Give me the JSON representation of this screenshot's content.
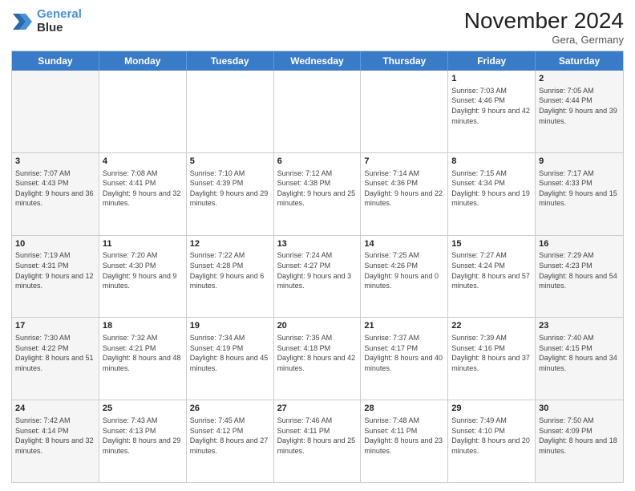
{
  "header": {
    "logo_line1": "General",
    "logo_line2": "Blue",
    "month": "November 2024",
    "location": "Gera, Germany"
  },
  "weekdays": [
    "Sunday",
    "Monday",
    "Tuesday",
    "Wednesday",
    "Thursday",
    "Friday",
    "Saturday"
  ],
  "rows": [
    [
      {
        "day": "",
        "info": ""
      },
      {
        "day": "",
        "info": ""
      },
      {
        "day": "",
        "info": ""
      },
      {
        "day": "",
        "info": ""
      },
      {
        "day": "",
        "info": ""
      },
      {
        "day": "1",
        "info": "Sunrise: 7:03 AM\nSunset: 4:46 PM\nDaylight: 9 hours and 42 minutes."
      },
      {
        "day": "2",
        "info": "Sunrise: 7:05 AM\nSunset: 4:44 PM\nDaylight: 9 hours and 39 minutes."
      }
    ],
    [
      {
        "day": "3",
        "info": "Sunrise: 7:07 AM\nSunset: 4:43 PM\nDaylight: 9 hours and 36 minutes."
      },
      {
        "day": "4",
        "info": "Sunrise: 7:08 AM\nSunset: 4:41 PM\nDaylight: 9 hours and 32 minutes."
      },
      {
        "day": "5",
        "info": "Sunrise: 7:10 AM\nSunset: 4:39 PM\nDaylight: 9 hours and 29 minutes."
      },
      {
        "day": "6",
        "info": "Sunrise: 7:12 AM\nSunset: 4:38 PM\nDaylight: 9 hours and 25 minutes."
      },
      {
        "day": "7",
        "info": "Sunrise: 7:14 AM\nSunset: 4:36 PM\nDaylight: 9 hours and 22 minutes."
      },
      {
        "day": "8",
        "info": "Sunrise: 7:15 AM\nSunset: 4:34 PM\nDaylight: 9 hours and 19 minutes."
      },
      {
        "day": "9",
        "info": "Sunrise: 7:17 AM\nSunset: 4:33 PM\nDaylight: 9 hours and 15 minutes."
      }
    ],
    [
      {
        "day": "10",
        "info": "Sunrise: 7:19 AM\nSunset: 4:31 PM\nDaylight: 9 hours and 12 minutes."
      },
      {
        "day": "11",
        "info": "Sunrise: 7:20 AM\nSunset: 4:30 PM\nDaylight: 9 hours and 9 minutes."
      },
      {
        "day": "12",
        "info": "Sunrise: 7:22 AM\nSunset: 4:28 PM\nDaylight: 9 hours and 6 minutes."
      },
      {
        "day": "13",
        "info": "Sunrise: 7:24 AM\nSunset: 4:27 PM\nDaylight: 9 hours and 3 minutes."
      },
      {
        "day": "14",
        "info": "Sunrise: 7:25 AM\nSunset: 4:26 PM\nDaylight: 9 hours and 0 minutes."
      },
      {
        "day": "15",
        "info": "Sunrise: 7:27 AM\nSunset: 4:24 PM\nDaylight: 8 hours and 57 minutes."
      },
      {
        "day": "16",
        "info": "Sunrise: 7:29 AM\nSunset: 4:23 PM\nDaylight: 8 hours and 54 minutes."
      }
    ],
    [
      {
        "day": "17",
        "info": "Sunrise: 7:30 AM\nSunset: 4:22 PM\nDaylight: 8 hours and 51 minutes."
      },
      {
        "day": "18",
        "info": "Sunrise: 7:32 AM\nSunset: 4:21 PM\nDaylight: 8 hours and 48 minutes."
      },
      {
        "day": "19",
        "info": "Sunrise: 7:34 AM\nSunset: 4:19 PM\nDaylight: 8 hours and 45 minutes."
      },
      {
        "day": "20",
        "info": "Sunrise: 7:35 AM\nSunset: 4:18 PM\nDaylight: 8 hours and 42 minutes."
      },
      {
        "day": "21",
        "info": "Sunrise: 7:37 AM\nSunset: 4:17 PM\nDaylight: 8 hours and 40 minutes."
      },
      {
        "day": "22",
        "info": "Sunrise: 7:39 AM\nSunset: 4:16 PM\nDaylight: 8 hours and 37 minutes."
      },
      {
        "day": "23",
        "info": "Sunrise: 7:40 AM\nSunset: 4:15 PM\nDaylight: 8 hours and 34 minutes."
      }
    ],
    [
      {
        "day": "24",
        "info": "Sunrise: 7:42 AM\nSunset: 4:14 PM\nDaylight: 8 hours and 32 minutes."
      },
      {
        "day": "25",
        "info": "Sunrise: 7:43 AM\nSunset: 4:13 PM\nDaylight: 8 hours and 29 minutes."
      },
      {
        "day": "26",
        "info": "Sunrise: 7:45 AM\nSunset: 4:12 PM\nDaylight: 8 hours and 27 minutes."
      },
      {
        "day": "27",
        "info": "Sunrise: 7:46 AM\nSunset: 4:11 PM\nDaylight: 8 hours and 25 minutes."
      },
      {
        "day": "28",
        "info": "Sunrise: 7:48 AM\nSunset: 4:11 PM\nDaylight: 8 hours and 23 minutes."
      },
      {
        "day": "29",
        "info": "Sunrise: 7:49 AM\nSunset: 4:10 PM\nDaylight: 8 hours and 20 minutes."
      },
      {
        "day": "30",
        "info": "Sunrise: 7:50 AM\nSunset: 4:09 PM\nDaylight: 8 hours and 18 minutes."
      }
    ]
  ]
}
